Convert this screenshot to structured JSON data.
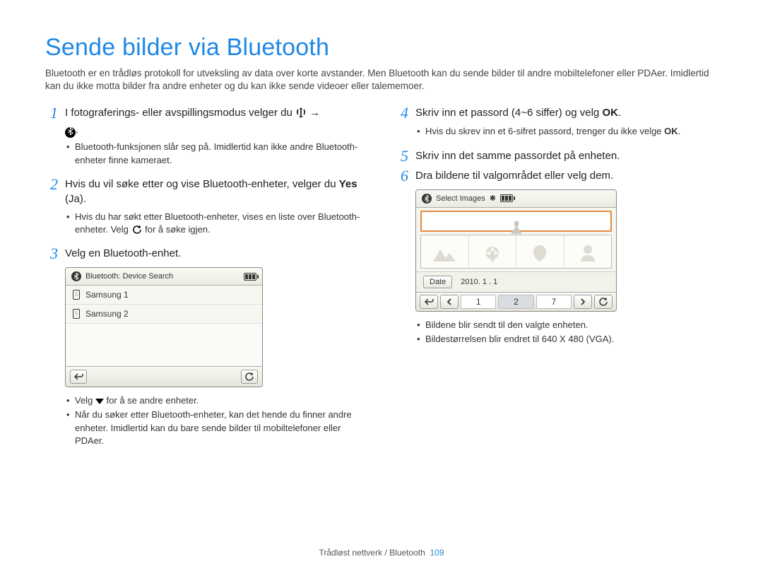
{
  "title": "Sende bilder via Bluetooth",
  "intro": "Bluetooth er en trådløs protokoll for utveksling av data over korte avstander. Men Bluetooth kan du sende bilder til andre mobiltelefoner eller PDAer. Imidlertid kan du ikke motta bilder fra andre enheter og du kan ikke sende videoer eller talememoer.",
  "left": {
    "step1_a": "I fotograferings- eller avspillingsmodus velger du ",
    "step1_arrow": " → ",
    "step1_b": ".",
    "step1_bullet": "Bluetooth-funksjonen slår seg på. Imidlertid kan ikke andre Bluetooth-enheter finne kameraet.",
    "step2_a": "Hvis du vil søke etter og vise Bluetooth-enheter, velger du ",
    "step2_yes": "Yes",
    "step2_b": " (Ja).",
    "step2_bullet_a": "Hvis du har søkt etter Bluetooth-enheter, vises en liste over Bluetooth-enheter. Velg ",
    "step2_bullet_b": " for å søke igjen.",
    "step3": "Velg en Bluetooth-enhet.",
    "device_title": "Bluetooth: Device Search",
    "device_item1": "Samsung 1",
    "device_item2": "Samsung 2",
    "after3_bullet1_a": "Velg ",
    "after3_bullet1_b": " for å se andre enheter.",
    "after3_bullet2": "Når du søker etter Bluetooth-enheter, kan det hende du finner andre enheter. Imidlertid kan du bare sende bilder til mobiltelefoner eller PDAer."
  },
  "right": {
    "step4_a": "Skriv inn et passord (4~6 siffer) og velg ",
    "step4_ok": "OK",
    "step4_b": ".",
    "step4_bullet_a": "Hvis du skrev inn et 6-sifret passord, trenger du ikke velge ",
    "step4_bullet_ok": "OK",
    "step4_bullet_b": ".",
    "step5": "Skriv inn det samme passordet på enheten.",
    "step6": "Dra bildene til valgområdet eller velg dem.",
    "device2_title": "Select Images",
    "date_label": "Date",
    "date_value": "2010. 1 . 1",
    "pager": {
      "p1": "1",
      "p2": "2",
      "p3": "7"
    },
    "after6_bullet1": "Bildene blir sendt til den valgte enheten.",
    "after6_bullet2": "Bildestørrelsen blir endret til 640 X 480 (VGA)."
  },
  "footer": {
    "section": "Trådløst nettverk / Bluetooth",
    "page": "109"
  }
}
